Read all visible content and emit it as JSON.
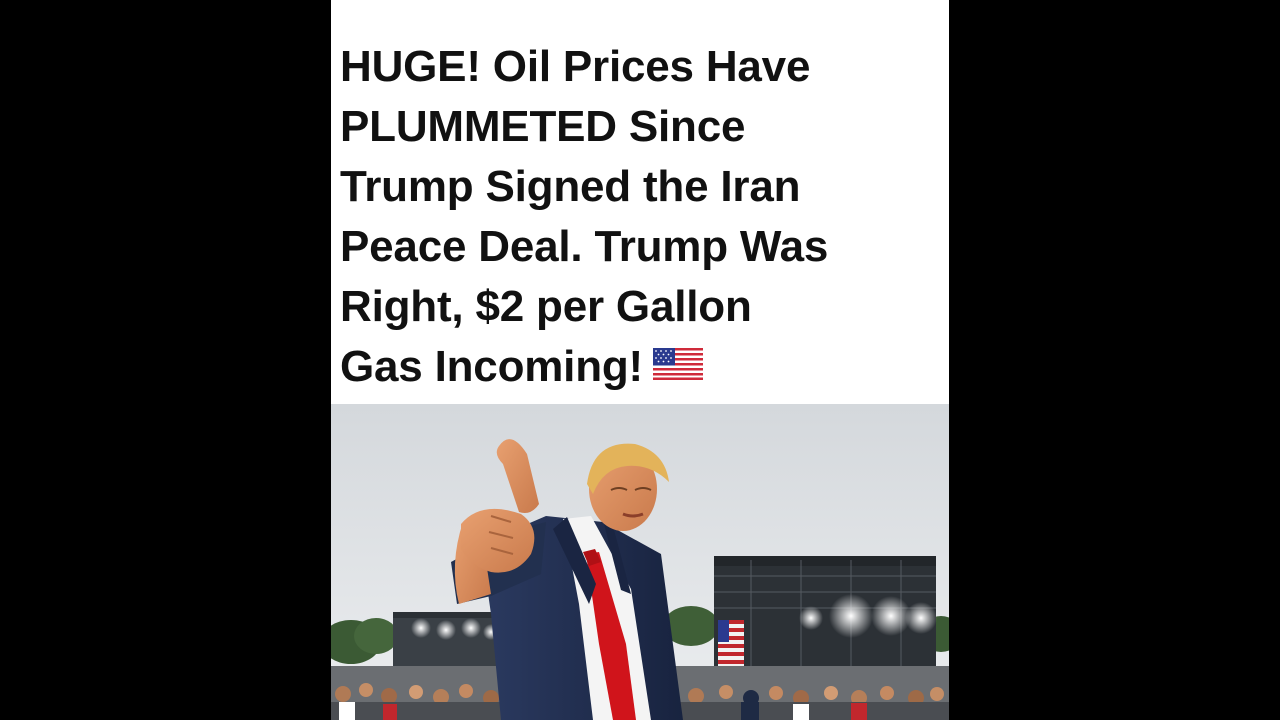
{
  "headline": {
    "lines": [
      "HUGE! Oil Prices Have",
      "PLUMMETED Since",
      "Trump Signed the Iran",
      "Peace Deal. Trump Was",
      "Right, $2 per Gallon",
      "Gas Incoming!"
    ],
    "emoji": "us-flag-emoji"
  },
  "photo": {
    "subject": "man-pointing-at-camera",
    "colors": {
      "sky": "#d9dde0",
      "suit": "#1f2d4f",
      "tie": "#d0141b",
      "hair": "#e3b35a",
      "stage": "#2e3338"
    }
  }
}
